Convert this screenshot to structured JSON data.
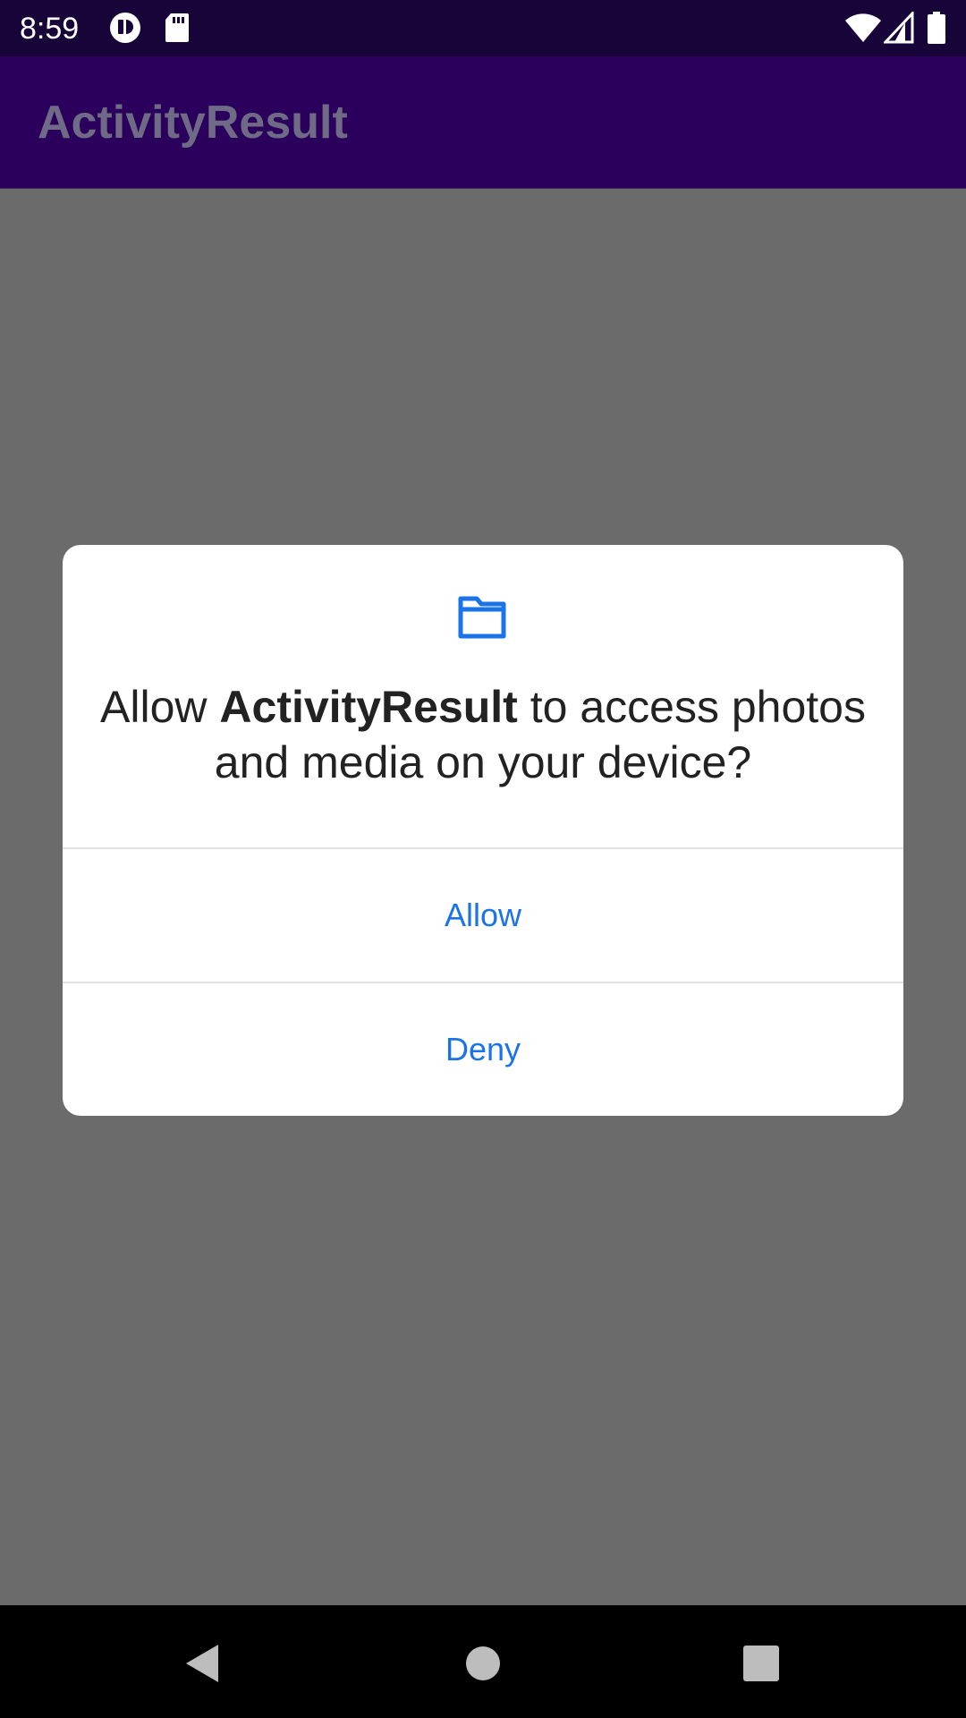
{
  "status_bar": {
    "time": "8:59",
    "left_icons": [
      "app-notification-icon",
      "sd-card-icon"
    ],
    "right_icons": [
      "wifi-icon",
      "cell-signal-icon",
      "battery-icon"
    ]
  },
  "app_bar": {
    "title": "ActivityResult"
  },
  "permission_dialog": {
    "icon": "folder-icon",
    "message_prefix": "Allow ",
    "app_name": "ActivityResult",
    "message_suffix": " to access photos and media on your device?",
    "allow_label": "Allow",
    "deny_label": "Deny",
    "accent_color": "#1a73e8"
  },
  "nav_bar": {
    "buttons": [
      "back-icon",
      "home-icon",
      "recents-icon"
    ]
  },
  "colors": {
    "status_bar": "#17053a",
    "app_bar": "#2a005c",
    "scrim": "#6b6b6b"
  }
}
